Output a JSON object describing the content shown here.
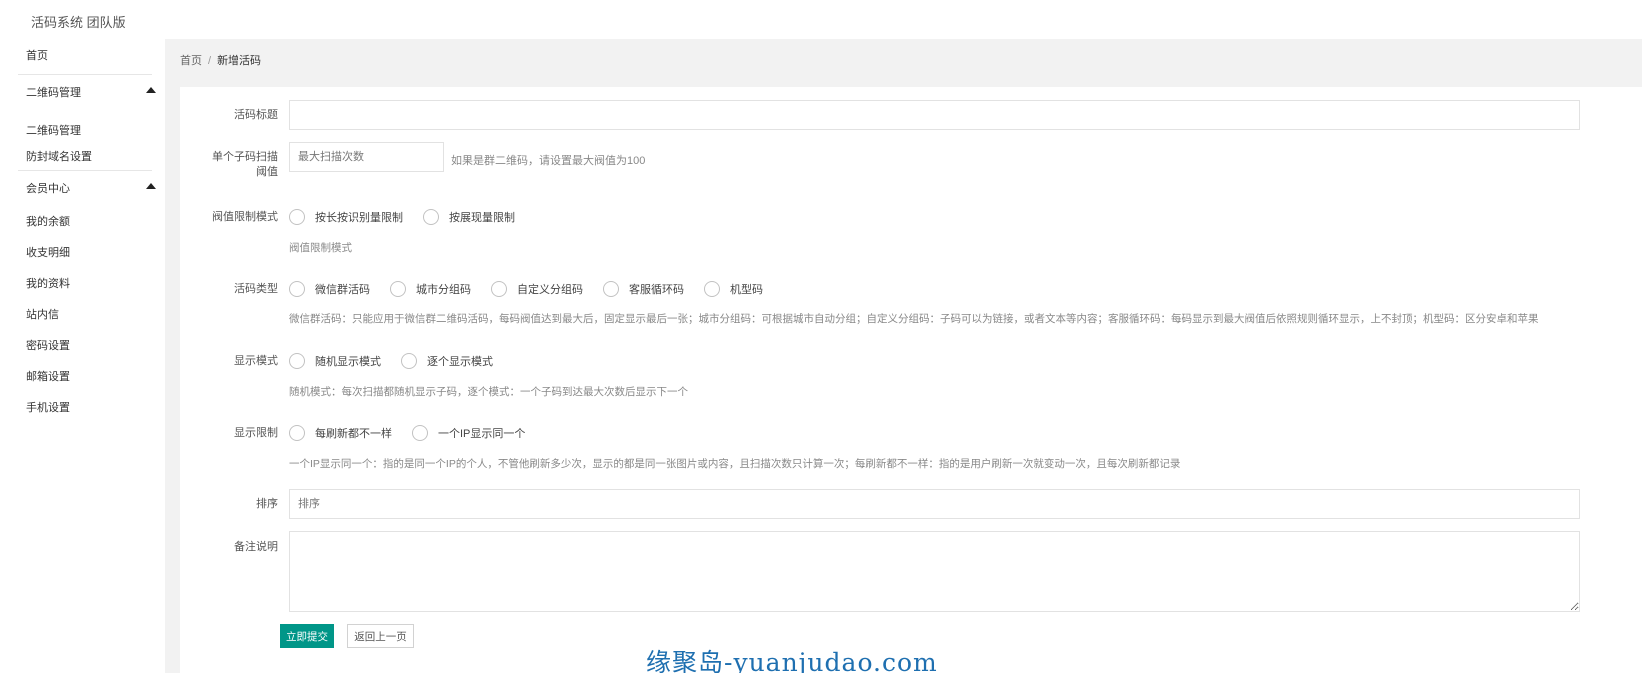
{
  "app": {
    "title": "活码系统 团队版"
  },
  "sidebar": {
    "home": "首页",
    "groups": [
      {
        "label": "二维码管理",
        "items": [
          "二维码管理",
          "防封域名设置"
        ]
      },
      {
        "label": "会员中心",
        "items": [
          "我的余额",
          "收支明细",
          "我的资料",
          "站内信",
          "密码设置",
          "邮箱设置",
          "手机设置"
        ]
      }
    ]
  },
  "breadcrumb": {
    "home": "首页",
    "separator": "/",
    "current": "新增活码"
  },
  "form": {
    "title": {
      "label": "活码标题",
      "value": ""
    },
    "threshold": {
      "label_line1": "单个子码扫描",
      "label_line2": "阈值",
      "placeholder": "最大扫描次数",
      "aux": "如果是群二维码，请设置最大阀值为100"
    },
    "limit_mode": {
      "label": "阀值限制模式",
      "options": [
        "按长按识别量限制",
        "按展现量限制"
      ],
      "hint": "阀值限制模式"
    },
    "code_type": {
      "label": "活码类型",
      "options": [
        "微信群活码",
        "城市分组码",
        "自定义分组码",
        "客服循环码",
        "机型码"
      ],
      "hint": "微信群活码：只能应用于微信群二维码活码，每码阀值达到最大后，固定显示最后一张；城市分组码：可根据城市自动分组；自定义分组码：子码可以为链接，或者文本等内容；客服循环码：每码显示到最大阀值后依照规则循环显示，上不封顶；机型码：区分安卓和苹果"
    },
    "display_mode": {
      "label": "显示模式",
      "options": [
        "随机显示模式",
        "逐个显示模式"
      ],
      "hint": "随机模式：每次扫描都随机显示子码，逐个模式：一个子码到达最大次数后显示下一个"
    },
    "display_limit": {
      "label": "显示限制",
      "options": [
        "每刷新都不一样",
        "一个IP显示同一个"
      ],
      "hint": "一个IP显示同一个：指的是同一个IP的个人，不管他刷新多少次，显示的都是同一张图片或内容，且扫描次数只计算一次；每刷新都不一样：指的是用户刷新一次就变动一次，且每次刷新都记录"
    },
    "sort": {
      "label": "排序",
      "placeholder": "排序"
    },
    "remark": {
      "label": "备注说明",
      "value": ""
    },
    "submit_label": "立即提交",
    "back_label": "返回上一页"
  },
  "watermark": "缘聚岛-yuanjudao.com",
  "colors": {
    "primary": "#009688",
    "sidebar_bg": "#ffffff",
    "content_bg": "#f2f2f2"
  }
}
